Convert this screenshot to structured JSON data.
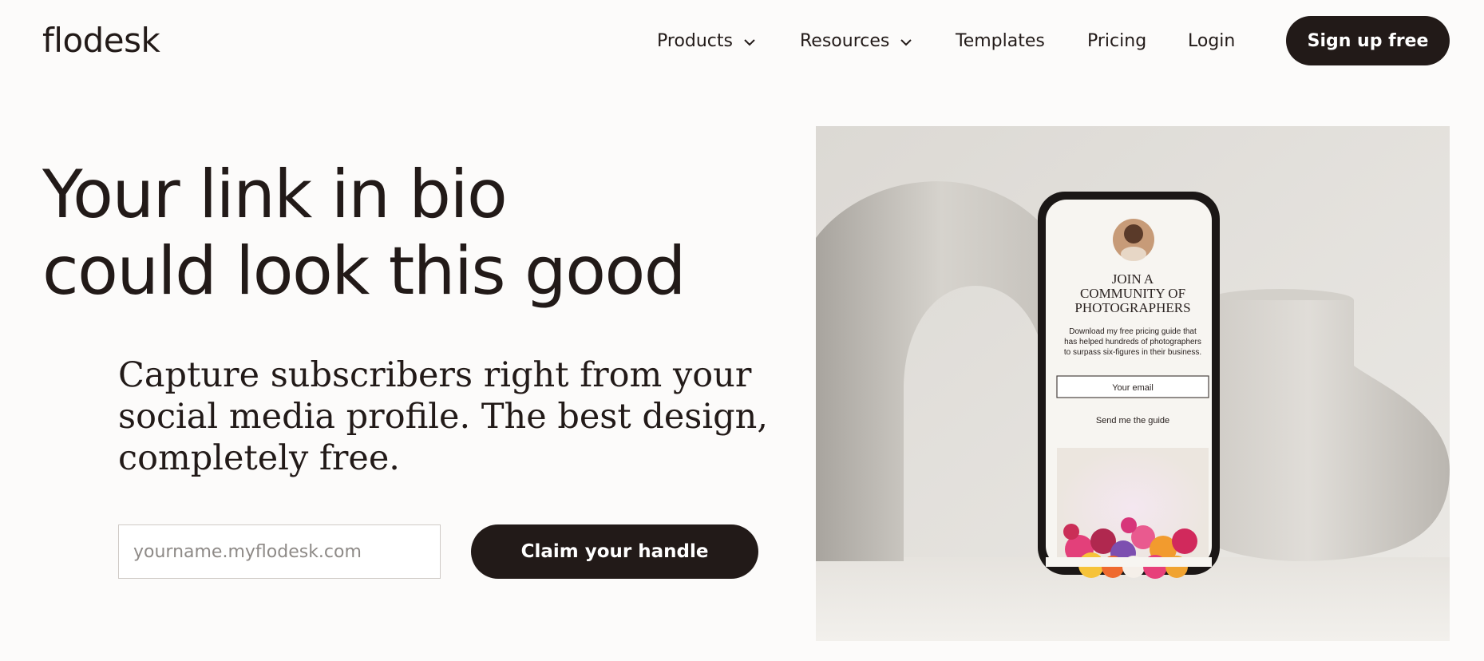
{
  "brand": {
    "logo_text": "flodesk"
  },
  "nav": {
    "items": [
      {
        "label": "Products",
        "has_dropdown": true
      },
      {
        "label": "Resources",
        "has_dropdown": true
      },
      {
        "label": "Templates",
        "has_dropdown": false
      },
      {
        "label": "Pricing",
        "has_dropdown": false
      },
      {
        "label": "Login",
        "has_dropdown": false
      }
    ],
    "cta_label": "Sign up free"
  },
  "hero": {
    "title_line1": "Your link in bio",
    "title_line2": "could look this good",
    "subtitle": "Capture subscribers right from your social media profile. The best design, completely free.",
    "input_placeholder": "yourname.myflodesk.com",
    "cta_label": "Claim your handle"
  },
  "phone": {
    "heading_line1": "JOIN A",
    "heading_line2": "COMMUNITY OF",
    "heading_line3": "PHOTOGRAPHERS",
    "body_line1": "Download my free pricing guide that",
    "body_line2": "has helped hundreds of photographers",
    "body_line3": "to surpass six-figures in their business.",
    "email_placeholder": "Your email",
    "button_label": "Send me the guide"
  },
  "colors": {
    "dark": "#221a18",
    "background": "#fcfbfa",
    "input_border": "#cfcac6"
  }
}
